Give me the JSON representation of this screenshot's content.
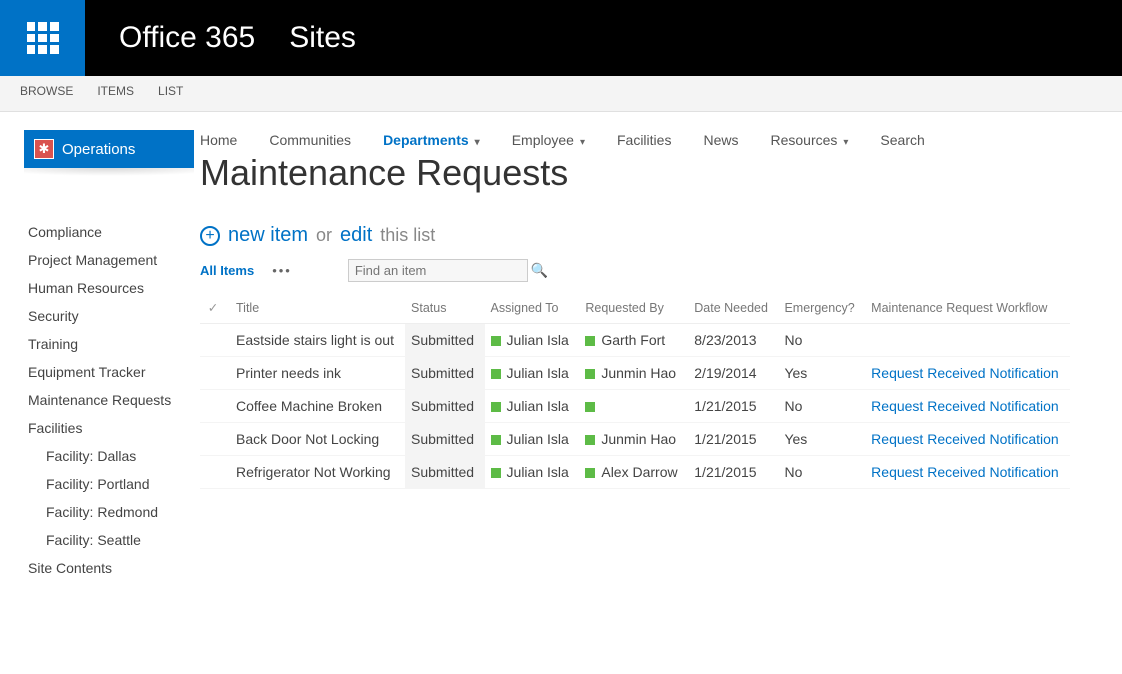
{
  "header": {
    "brand": "Office 365",
    "app": "Sites"
  },
  "ribbon": [
    "BROWSE",
    "ITEMS",
    "LIST"
  ],
  "site": {
    "title": "Operations"
  },
  "quicklaunch": [
    {
      "label": "Compliance",
      "sub": false
    },
    {
      "label": "Project Management",
      "sub": false
    },
    {
      "label": "Human Resources",
      "sub": false
    },
    {
      "label": "Security",
      "sub": false
    },
    {
      "label": "Training",
      "sub": false
    },
    {
      "label": "Equipment Tracker",
      "sub": false
    },
    {
      "label": "Maintenance Requests",
      "sub": false
    },
    {
      "label": "Facilities",
      "sub": false
    },
    {
      "label": "Facility: Dallas",
      "sub": true
    },
    {
      "label": "Facility: Portland",
      "sub": true
    },
    {
      "label": "Facility: Redmond",
      "sub": true
    },
    {
      "label": "Facility: Seattle",
      "sub": true
    },
    {
      "label": "Site Contents",
      "sub": false
    }
  ],
  "topnav": {
    "items": [
      "Home",
      "Communities",
      "Departments",
      "Employee",
      "Facilities",
      "News",
      "Resources",
      "Search"
    ],
    "active": "Departments",
    "dropdowns": [
      "Departments",
      "Employee",
      "Resources"
    ]
  },
  "page": {
    "title": "Maintenance Requests"
  },
  "actions": {
    "new_item": "new item",
    "or": "or",
    "edit": "edit",
    "this_list": "this list"
  },
  "view": {
    "all_items": "All Items",
    "search_placeholder": "Find an item"
  },
  "columns": [
    "",
    "Title",
    "Status",
    "Assigned To",
    "Requested By",
    "Date Needed",
    "Emergency?",
    "Maintenance Request Workflow"
  ],
  "rows": [
    {
      "title": "Eastside stairs light is out",
      "status": "Submitted",
      "assigned": "Julian Isla",
      "requested": "Garth Fort",
      "date": "8/23/2013",
      "emergency": "No",
      "workflow": ""
    },
    {
      "title": "Printer needs ink",
      "status": "Submitted",
      "assigned": "Julian Isla",
      "requested": "Junmin Hao",
      "date": "2/19/2014",
      "emergency": "Yes",
      "workflow": "Request Received Notification"
    },
    {
      "title": "Coffee Machine Broken",
      "status": "Submitted",
      "assigned": "Julian Isla",
      "requested": "",
      "date": "1/21/2015",
      "emergency": "No",
      "workflow": "Request Received Notification"
    },
    {
      "title": "Back Door Not Locking",
      "status": "Submitted",
      "assigned": "Julian Isla",
      "requested": "Junmin Hao",
      "date": "1/21/2015",
      "emergency": "Yes",
      "workflow": "Request Received Notification"
    },
    {
      "title": "Refrigerator Not Working",
      "status": "Submitted",
      "assigned": "Julian Isla",
      "requested": "Alex Darrow",
      "date": "1/21/2015",
      "emergency": "No",
      "workflow": "Request Received Notification"
    }
  ]
}
